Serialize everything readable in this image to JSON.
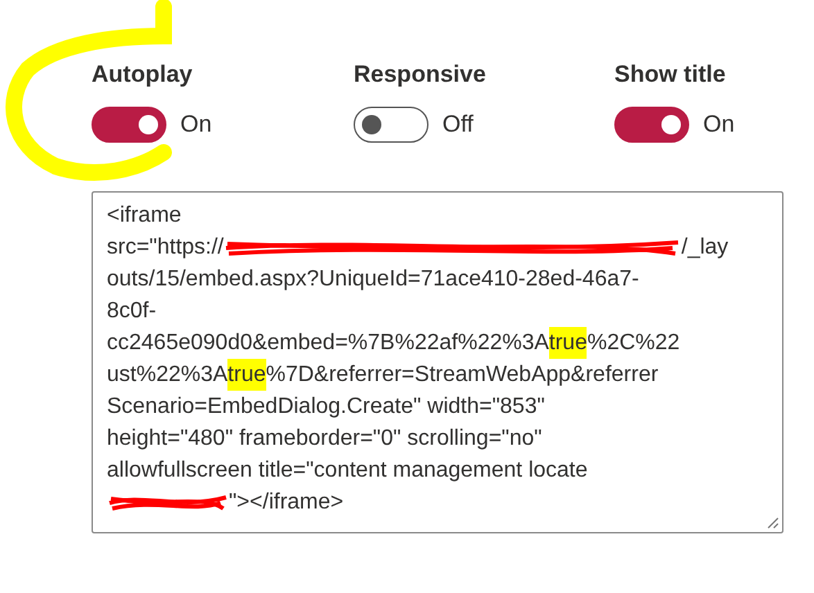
{
  "toggles": [
    {
      "label": "Autoplay",
      "on": true,
      "state_text": "On"
    },
    {
      "label": "Responsive",
      "on": false,
      "state_text": "Off"
    },
    {
      "label": "Show title",
      "on": true,
      "state_text": "On"
    }
  ],
  "circle_annotation": true,
  "embed_code": {
    "lines": [
      [
        {
          "kind": "plain",
          "text": "<iframe"
        }
      ],
      [
        {
          "kind": "plain",
          "text": "src=\"https://"
        },
        {
          "kind": "redaction"
        },
        {
          "kind": "plain",
          "text": "/_lay"
        }
      ],
      [
        {
          "kind": "plain",
          "text": "outs/15/embed.aspx?UniqueId=71ace410-28ed-46a7-"
        }
      ],
      [
        {
          "kind": "plain",
          "text": "8c0f-"
        }
      ],
      [
        {
          "kind": "plain",
          "text": "cc2465e090d0&embed=%7B%22af%22%3A"
        },
        {
          "kind": "highlight",
          "text": "true"
        },
        {
          "kind": "plain",
          "text": "%2C%22"
        }
      ],
      [
        {
          "kind": "plain",
          "text": "ust%22%3A"
        },
        {
          "kind": "highlight",
          "text": "true"
        },
        {
          "kind": "plain",
          "text": "%7D&referrer=StreamWebApp&referrer"
        }
      ],
      [
        {
          "kind": "plain",
          "text": "Scenario=EmbedDialog.Create\" width=\"853\""
        }
      ],
      [
        {
          "kind": "plain",
          "text": "height=\"480\" frameborder=\"0\" scrolling=\"no\""
        }
      ],
      [
        {
          "kind": "plain",
          "text": "allowfullscreen title=\"content management locate"
        }
      ],
      [
        {
          "kind": "redaction-short"
        },
        {
          "kind": "plain",
          "text": "\"></iframe>"
        }
      ]
    ]
  }
}
